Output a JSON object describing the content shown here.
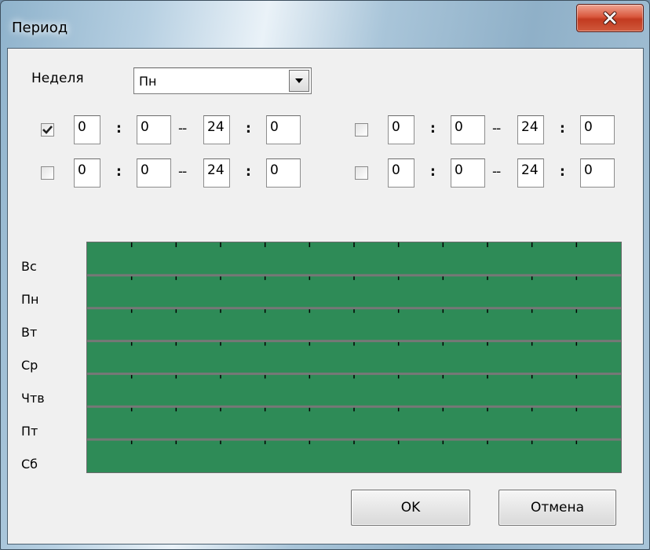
{
  "window": {
    "title": "Период"
  },
  "week": {
    "label": "Неделя",
    "selected": "Пн"
  },
  "periods": [
    {
      "checked": true,
      "start_h": "0",
      "start_m": "0",
      "end_h": "24",
      "end_m": "0"
    },
    {
      "checked": false,
      "start_h": "0",
      "start_m": "0",
      "end_h": "24",
      "end_m": "0"
    },
    {
      "checked": false,
      "start_h": "0",
      "start_m": "0",
      "end_h": "24",
      "end_m": "0"
    },
    {
      "checked": false,
      "start_h": "0",
      "start_m": "0",
      "end_h": "24",
      "end_m": "0"
    }
  ],
  "separator": ":",
  "range_separator": "--",
  "days": [
    "Вс",
    "Пн",
    "Вт",
    "Ср",
    "Чтв",
    "Пт",
    "Сб"
  ],
  "schedule": {
    "fill_color": "#2e8b57",
    "active_fraction": 1.0
  },
  "buttons": {
    "ok": "OK",
    "cancel": "Отмена"
  }
}
